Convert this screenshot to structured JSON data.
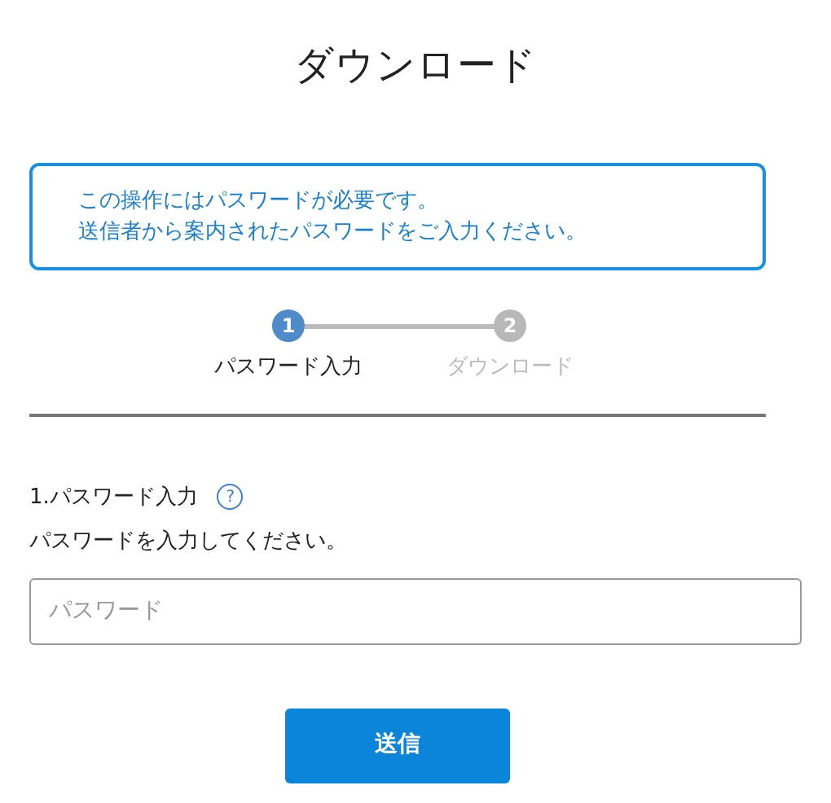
{
  "title": "ダウンロード",
  "notice": [
    "この操作にはパスワードが必要です。",
    "送信者から案内されたパスワードをご入力ください。"
  ],
  "steps": [
    {
      "number": "1",
      "label": "パスワード入力",
      "selected": true
    },
    {
      "number": "2",
      "label": "ダウンロード",
      "selected": false
    }
  ],
  "section": {
    "heading": "1.パスワード入力",
    "help": "?",
    "instruction": "パスワードを入力してください。"
  },
  "password_field": {
    "placeholder": "パスワード"
  },
  "submit_button": "送信"
}
